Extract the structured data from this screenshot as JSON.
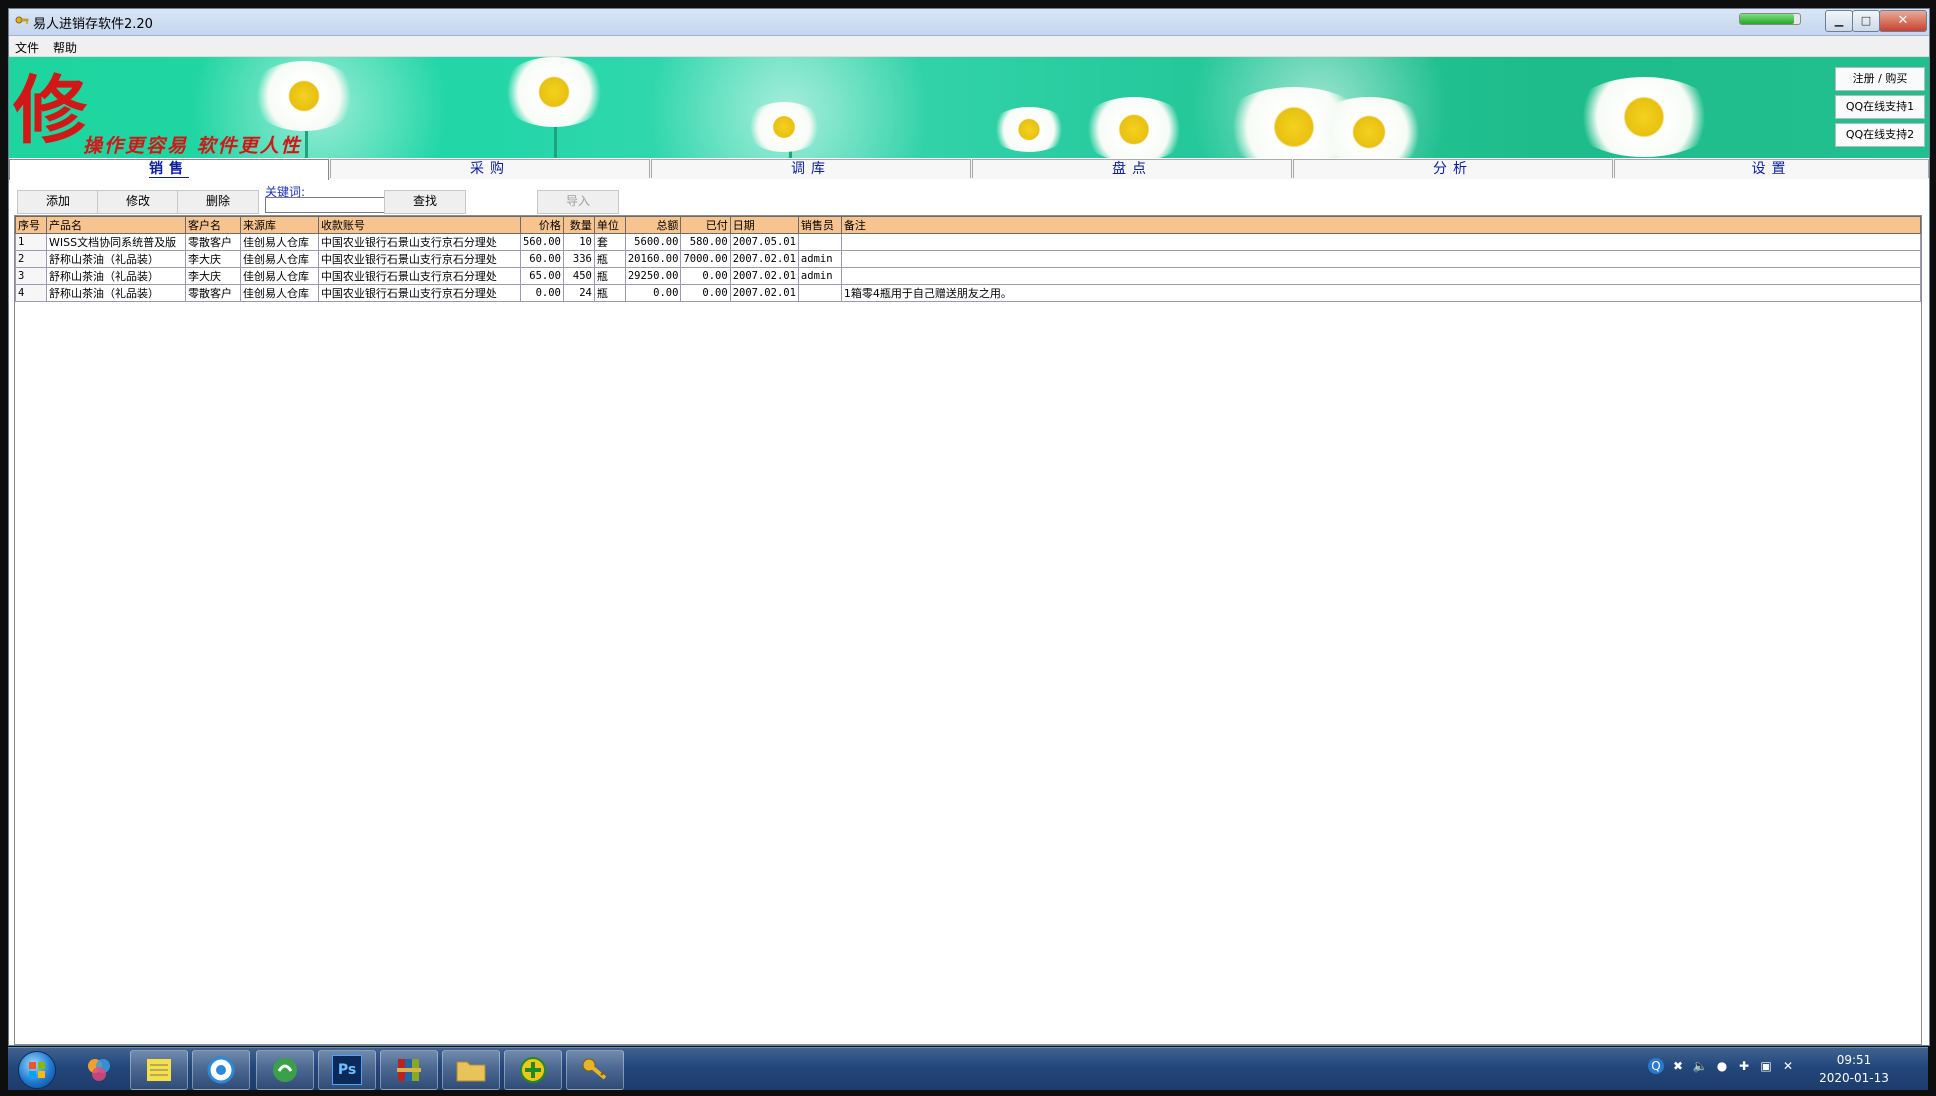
{
  "window": {
    "title": "易人进销存软件2.20",
    "progress_fraction": 0.9
  },
  "menu": [
    "文件",
    "帮助"
  ],
  "banner": {
    "seal_char": "修",
    "slogan": "操作更容易 软件更人性",
    "side_buttons": [
      "注册 / 购买",
      "QQ在线支持1",
      "QQ在线支持2"
    ]
  },
  "tabs": [
    {
      "label": "销售",
      "active": true
    },
    {
      "label": "采购",
      "active": false
    },
    {
      "label": "调库",
      "active": false
    },
    {
      "label": "盘点",
      "active": false
    },
    {
      "label": "分析",
      "active": false
    },
    {
      "label": "设置",
      "active": false
    }
  ],
  "toolbar": {
    "add": "添加",
    "edit": "修改",
    "delete": "删除",
    "keyword_label": "关键词:",
    "keyword_value": "",
    "search": "查找",
    "import": "导入"
  },
  "table": {
    "columns": [
      "序号",
      "产品名",
      "客户名",
      "来源库",
      "收款账号",
      "价格",
      "数量",
      "单位",
      "总额",
      "已付",
      "日期",
      "销售员",
      "备注"
    ],
    "rows": [
      [
        "1",
        "WISS文档协同系统普及版",
        "零散客户",
        "佳创易人仓库",
        "中国农业银行石景山支行京石分理处",
        "560.00",
        "10",
        "套",
        "5600.00",
        "580.00",
        "2007.05.01",
        "",
        ""
      ],
      [
        "2",
        "舒称山茶油（礼品装）",
        "李大庆",
        "佳创易人仓库",
        "中国农业银行石景山支行京石分理处",
        "60.00",
        "336",
        "瓶",
        "20160.00",
        "7000.00",
        "2007.02.01",
        "admin",
        ""
      ],
      [
        "3",
        "舒称山茶油（礼品装）",
        "李大庆",
        "佳创易人仓库",
        "中国农业银行石景山支行京石分理处",
        "65.00",
        "450",
        "瓶",
        "29250.00",
        "0.00",
        "2007.02.01",
        "admin",
        ""
      ],
      [
        "4",
        "舒称山茶油（礼品装）",
        "零散客户",
        "佳创易人仓库",
        "中国农业银行石景山支行京石分理处",
        "0.00",
        "24",
        "瓶",
        "0.00",
        "0.00",
        "2007.02.01",
        "",
        "1箱零4瓶用于自己赠送朋友之用。"
      ]
    ]
  },
  "taskbar": {
    "apps": [
      "start-menu",
      "color-app-icon",
      "notepad-icon",
      "browser-icon",
      "sync-app-icon",
      "photoshop-icon",
      "archive-icon",
      "folder-icon",
      "plus-app-icon",
      "key-app-icon"
    ],
    "ps_label": "Ps",
    "clock_time": "09:51",
    "clock_date": "2020-01-13"
  }
}
